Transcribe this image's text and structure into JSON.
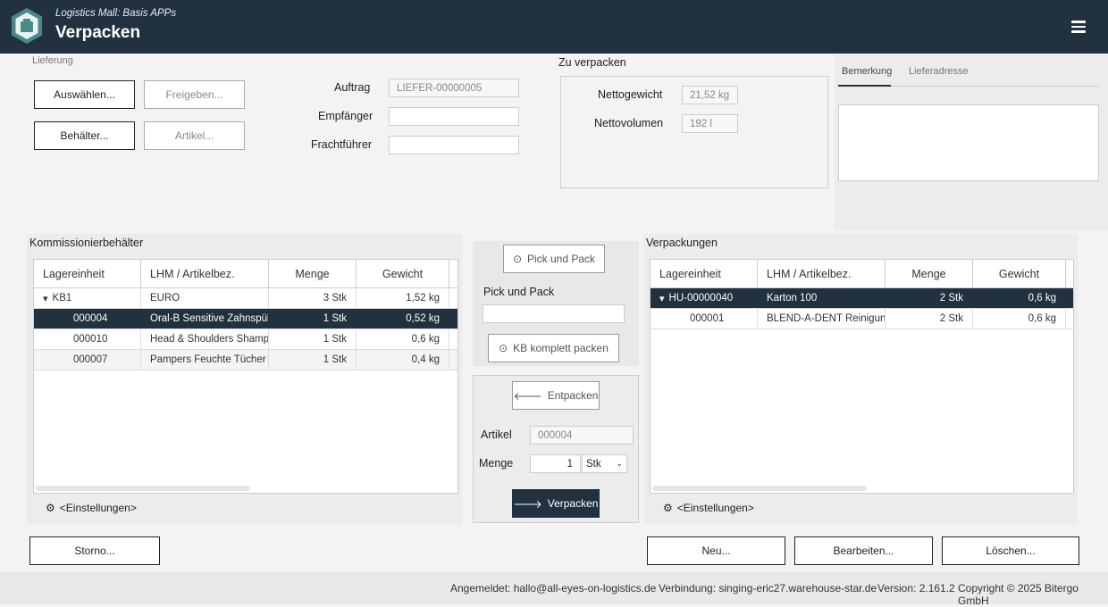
{
  "header": {
    "subtitle": "Logistics Mall: Basis APPs",
    "title": "Verpacken"
  },
  "lieferung": {
    "label": "Lieferung",
    "auswaehlen": "Auswählen...",
    "freigeben": "Freigeben...",
    "behaelter": "Behälter...",
    "artikel": "Artikel...",
    "auftrag_label": "Auftrag",
    "auftrag_value": "LIEFER-00000005",
    "empfaenger_label": "Empfänger",
    "empfaenger_value": "",
    "frachtfuehrer_label": "Frachtführer",
    "frachtfuehrer_value": ""
  },
  "zu_verpacken": {
    "label": "Zu verpacken",
    "nettogewicht_label": "Nettogewicht",
    "nettogewicht_value": "21,52 kg",
    "nettovolumen_label": "Nettovolumen",
    "nettovolumen_value": "192 l"
  },
  "tabs": {
    "bemerkung": "Bemerkung",
    "lieferadresse": "Lieferadresse"
  },
  "kommissionierbehaelter": {
    "label": "Kommissionierbehälter",
    "columns": [
      "Lagereinheit",
      "LHM / Artikelbez.",
      "Menge",
      "Gewicht"
    ],
    "rows": [
      [
        "KB1",
        "EURO",
        "3 Stk",
        "1,52 kg"
      ],
      [
        "000004",
        "Oral-B Sensitive Zahnspülung",
        "1 Stk",
        "0,52 kg"
      ],
      [
        "000010",
        "Head & Shoulders Shampoo",
        "1 Stk",
        "0,6 kg"
      ],
      [
        "000007",
        "Pampers Feuchte Tücher Baby",
        "1 Stk",
        "0,4 kg"
      ]
    ],
    "settings": "<Einstellungen>"
  },
  "middle": {
    "pick_und_pack_button": "Pick und Pack",
    "pick_und_pack_label": "Pick und Pack",
    "pick_und_pack_value": "",
    "kb_komplett": "KB komplett packen",
    "entpacken": "Entpacken",
    "artikel_label": "Artikel",
    "artikel_value": "000004",
    "menge_label": "Menge",
    "menge_value": "1",
    "unit": "Stk",
    "verpacken": "Verpacken"
  },
  "verpackungen": {
    "label": "Verpackungen",
    "columns": [
      "Lagereinheit",
      "LHM / Artikelbez.",
      "Menge",
      "Gewicht"
    ],
    "rows": [
      [
        "HU-00000040",
        "Karton 100",
        "2 Stk",
        "0,6 kg"
      ],
      [
        "000001",
        "BLEND-A-DENT Reinigungstabletten",
        "2 Stk",
        "0,6 kg"
      ]
    ],
    "settings": "<Einstellungen>"
  },
  "actions": {
    "storno": "Storno...",
    "neu": "Neu...",
    "bearbeiten": "Bearbeiten...",
    "loeschen": "Löschen..."
  },
  "footer": {
    "angemeldet": "Angemeldet: hallo@all-eyes-on-logistics.de",
    "verbindung": "Verbindung: singing-eric27.warehouse-star.de",
    "version": "Version: 2.161.2",
    "copyright": "Copyright © 2025 Bitergo GmbH"
  },
  "colors": {
    "header": "#22313f",
    "selected": "#22313f"
  }
}
